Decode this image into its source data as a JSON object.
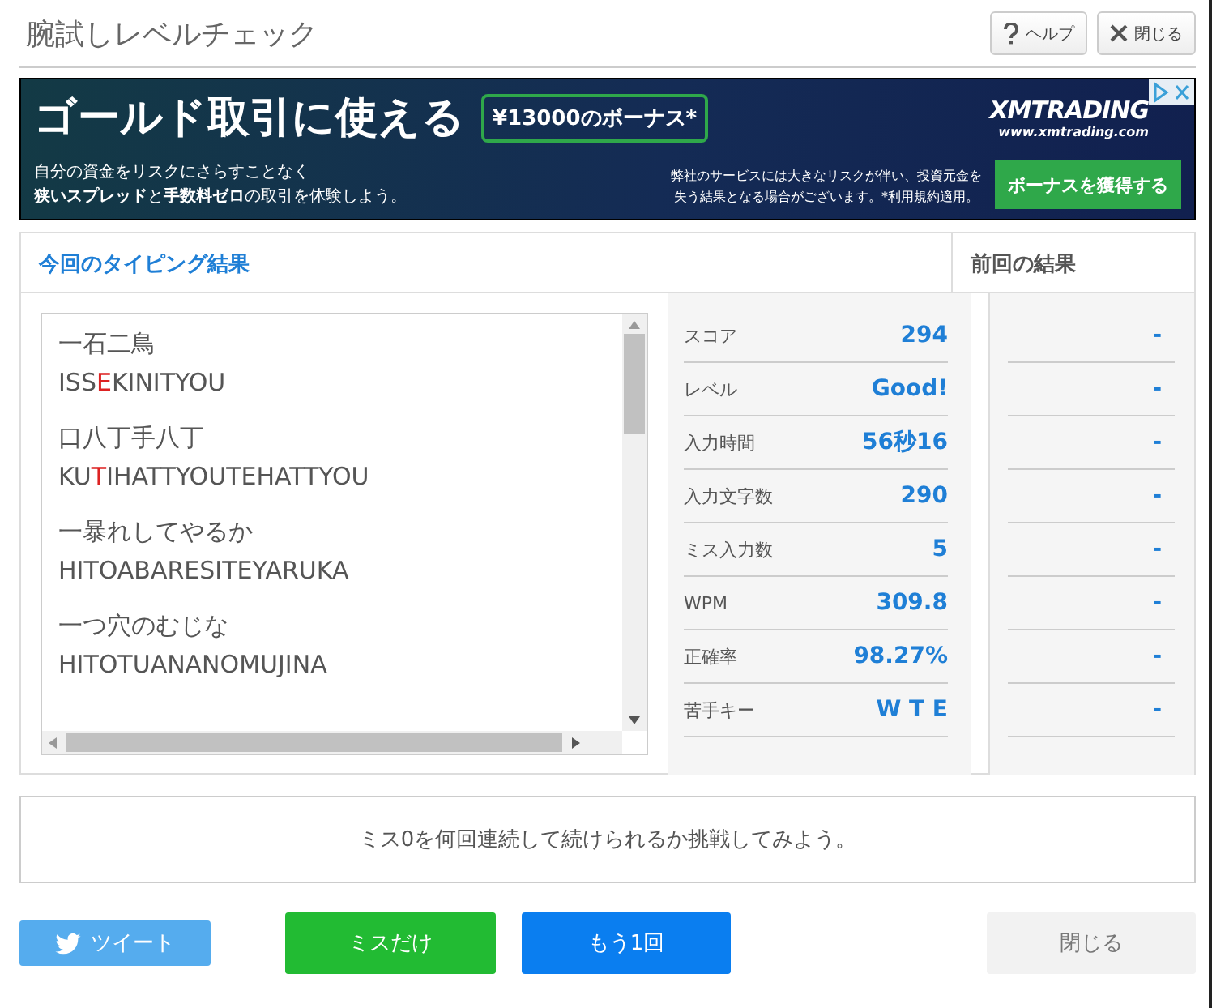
{
  "window": {
    "title": "腕試しレベルチェック",
    "buttons": [
      {
        "kind": "help",
        "label": "ヘルプ"
      },
      {
        "kind": "close",
        "label": "閉じる"
      }
    ]
  },
  "ad": {
    "headline": "ゴールド取引に使える",
    "bonus": "¥13000のボーナス*",
    "brand": "XMTRADING",
    "url": "www.xmtrading.com",
    "body_lines": [
      "自分の資金をリスクにさらすことなく",
      "**狭いスプレッド**と**手数料ゼロ**の取引を体験しよう。"
    ],
    "disclaimer_lines": [
      "弊社のサービスには大きなリスクが伴い、投資元金を",
      "失う結果となる場合がございます。*利用規約適用。"
    ],
    "cta": "ボーナスを獲得する"
  },
  "results": {
    "current_title": "今回のタイピング結果",
    "previous_title": "前回の結果",
    "words": [
      {
        "kanji": "一石二鳥",
        "romaji": [
          {
            "text": "ISS",
            "miss": false
          },
          {
            "text": "E",
            "miss": true
          },
          {
            "text": "KINITYOU",
            "miss": false
          }
        ]
      },
      {
        "kanji": "口八丁手八丁",
        "romaji": [
          {
            "text": "KU",
            "miss": false
          },
          {
            "text": "T",
            "miss": true
          },
          {
            "text": "IHATTYOUTEHATTYOU",
            "miss": false
          }
        ]
      },
      {
        "kanji": "一暴れしてやるか",
        "romaji": [
          {
            "text": "HITOABARESITEYARUKA",
            "miss": false
          }
        ]
      },
      {
        "kanji": "一つ穴のむじな",
        "romaji": [
          {
            "text": "HITOTUANANOMUJINA",
            "miss": false
          }
        ]
      }
    ],
    "stats": [
      {
        "label": "スコア",
        "value": "294",
        "previous": "-"
      },
      {
        "label": "レベル",
        "value": "Good!",
        "previous": "-"
      },
      {
        "label": "入力時間",
        "value": "56秒16",
        "previous": "-"
      },
      {
        "label": "入力文字数",
        "value": "290",
        "previous": "-"
      },
      {
        "label": "ミス入力数",
        "value": "5",
        "previous": "-"
      },
      {
        "label": "WPM",
        "value": "309.8",
        "previous": "-"
      },
      {
        "label": "正確率",
        "value": "98.27%",
        "previous": "-"
      },
      {
        "label": "苦手キー",
        "value": "W T E",
        "previous": "-"
      }
    ]
  },
  "message": "ミス0を何回連続して続けられるか挑戦してみよう。",
  "actions": [
    {
      "kind": "tweet",
      "label": "ツイート"
    },
    {
      "kind": "misses",
      "label": "ミスだけ"
    },
    {
      "kind": "retry",
      "label": "もう1回"
    },
    {
      "kind": "close",
      "label": "閉じる"
    }
  ]
}
